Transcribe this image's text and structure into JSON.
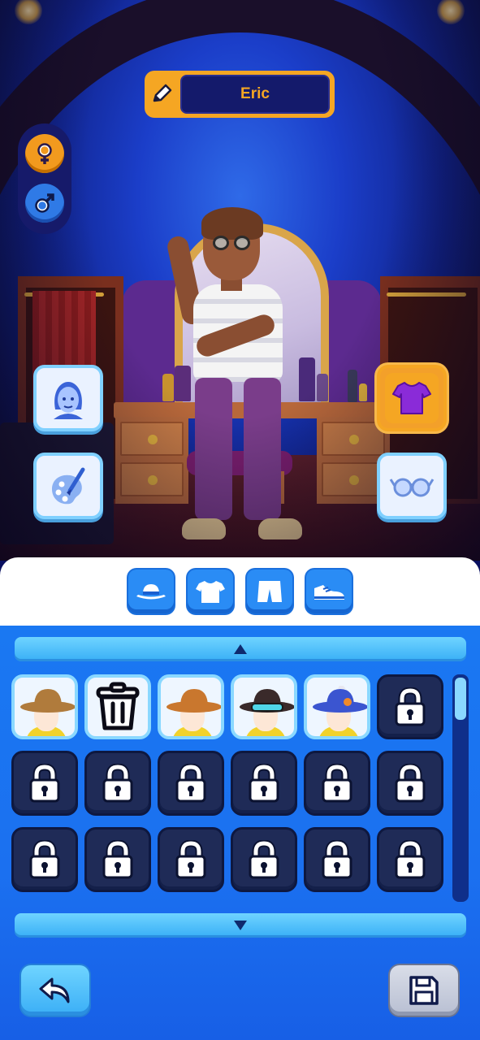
{
  "player": {
    "name": "Eric"
  },
  "gender": {
    "female_icon": "female-symbol-icon",
    "male_icon": "male-symbol-icon",
    "selected": "male"
  },
  "left_tools": [
    {
      "name": "face",
      "icon": "face-icon"
    },
    {
      "name": "paint",
      "icon": "paint-palette-icon"
    }
  ],
  "right_tools": [
    {
      "name": "clothing",
      "icon": "tshirt-icon",
      "selected": true
    },
    {
      "name": "accessories",
      "icon": "glasses-icon"
    }
  ],
  "category_tabs": [
    {
      "name": "hat",
      "icon": "hat-icon"
    },
    {
      "name": "shirt",
      "icon": "shirt-icon"
    },
    {
      "name": "pants",
      "icon": "shorts-icon"
    },
    {
      "name": "shoes",
      "icon": "shoe-icon"
    }
  ],
  "items": [
    {
      "state": "unlocked",
      "kind": "straw-hat"
    },
    {
      "state": "unlocked",
      "kind": "remove"
    },
    {
      "state": "unlocked",
      "kind": "cowboy-hat"
    },
    {
      "state": "unlocked",
      "kind": "spiky-goggles"
    },
    {
      "state": "unlocked",
      "kind": "crest-helmet"
    },
    {
      "state": "locked"
    },
    {
      "state": "locked"
    },
    {
      "state": "locked"
    },
    {
      "state": "locked"
    },
    {
      "state": "locked"
    },
    {
      "state": "locked"
    },
    {
      "state": "locked"
    },
    {
      "state": "locked"
    },
    {
      "state": "locked"
    },
    {
      "state": "locked"
    },
    {
      "state": "locked"
    },
    {
      "state": "locked"
    },
    {
      "state": "locked"
    }
  ],
  "colors": {
    "accent_orange": "#f5a623",
    "panel_blue": "#1a78f2",
    "light_blue": "#8ad8ff",
    "name_text": "#f5a623"
  }
}
